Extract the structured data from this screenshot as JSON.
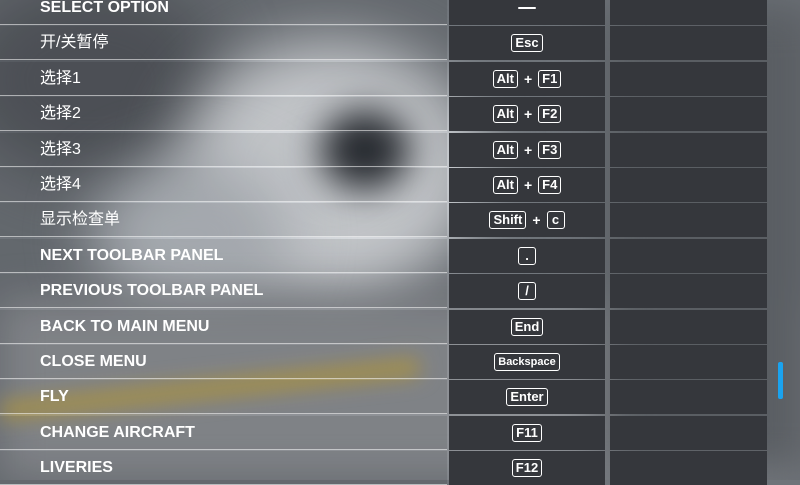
{
  "rows": [
    {
      "label": "SELECT OPTION",
      "caps": true,
      "keys": [
        ""
      ]
    },
    {
      "label": "开/关暂停",
      "caps": false,
      "keys": [
        "Esc"
      ]
    },
    {
      "label": "选择1",
      "caps": false,
      "keys": [
        "Alt",
        "F1"
      ]
    },
    {
      "label": "选择2",
      "caps": false,
      "keys": [
        "Alt",
        "F2"
      ]
    },
    {
      "label": "选择3",
      "caps": false,
      "keys": [
        "Alt",
        "F3"
      ]
    },
    {
      "label": "选择4",
      "caps": false,
      "keys": [
        "Alt",
        "F4"
      ]
    },
    {
      "label": "显示检查单",
      "caps": false,
      "keys": [
        "Shift",
        "c"
      ]
    },
    {
      "label": "NEXT TOOLBAR PANEL",
      "caps": true,
      "keys": [
        "."
      ]
    },
    {
      "label": "PREVIOUS TOOLBAR PANEL",
      "caps": true,
      "keys": [
        "/"
      ]
    },
    {
      "label": "BACK TO MAIN MENU",
      "caps": true,
      "keys": [
        "End"
      ]
    },
    {
      "label": "CLOSE MENU",
      "caps": true,
      "keys": [
        "Backspace"
      ]
    },
    {
      "label": "FLY",
      "caps": true,
      "keys": [
        "Enter"
      ]
    },
    {
      "label": "CHANGE AIRCRAFT",
      "caps": true,
      "keys": [
        "F11"
      ]
    },
    {
      "label": "LIVERIES",
      "caps": true,
      "keys": [
        "F12"
      ]
    }
  ],
  "plus_sign": "+",
  "colors": {
    "key_cell": "#35373c",
    "scrollbar_thumb": "#1aa3ef",
    "text": "#ffffff"
  }
}
